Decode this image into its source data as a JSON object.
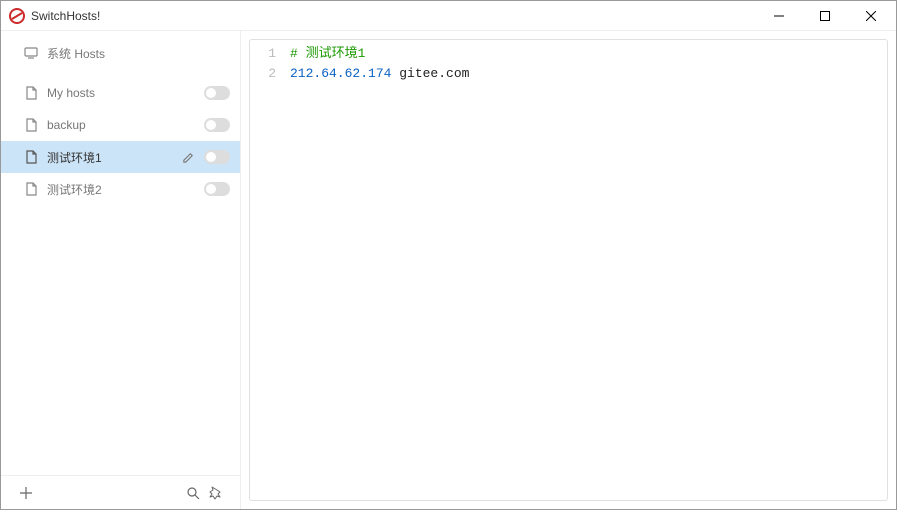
{
  "titlebar": {
    "title": "SwitchHosts!"
  },
  "sidebar": {
    "items": [
      {
        "label": "系统 Hosts",
        "kind": "system",
        "selected": false,
        "hasToggle": false
      },
      {
        "label": "My hosts",
        "kind": "file",
        "selected": false,
        "hasToggle": true
      },
      {
        "label": "backup",
        "kind": "file",
        "selected": false,
        "hasToggle": true
      },
      {
        "label": "测试环境1",
        "kind": "file",
        "selected": true,
        "hasToggle": true
      },
      {
        "label": "测试环境2",
        "kind": "file",
        "selected": false,
        "hasToggle": true
      }
    ]
  },
  "editor": {
    "lines": [
      {
        "n": "1",
        "tokens": [
          {
            "t": "# 测试环境1",
            "cls": "tok-comment"
          }
        ]
      },
      {
        "n": "2",
        "tokens": [
          {
            "t": "212.64.62.174",
            "cls": "tok-ip"
          },
          {
            "t": " gitee.com",
            "cls": "tok-host"
          }
        ]
      }
    ]
  }
}
